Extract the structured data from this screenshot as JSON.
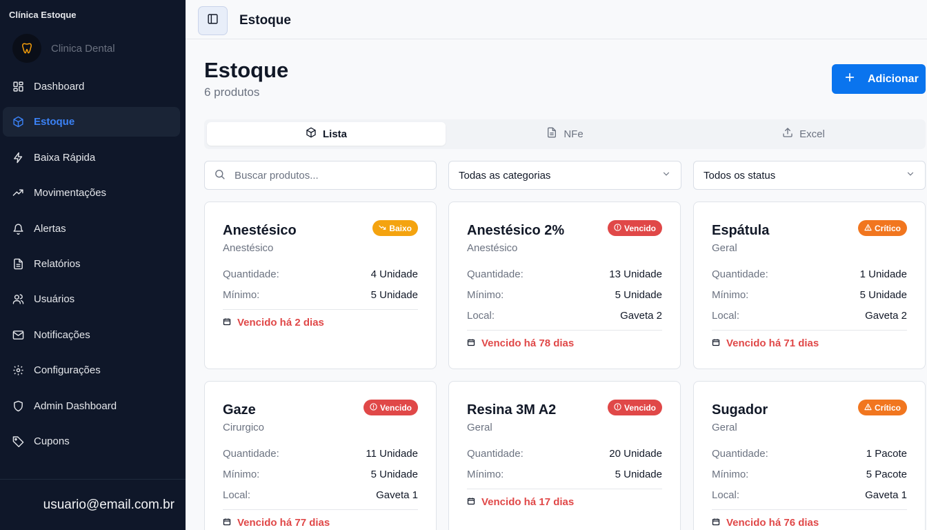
{
  "app": {
    "title": "Clínica Estoque",
    "clinic_name": "Clinica Dental"
  },
  "sidebar": {
    "items": [
      {
        "label": "Dashboard",
        "icon": "grid-icon"
      },
      {
        "label": "Estoque",
        "icon": "box-icon",
        "active": true
      },
      {
        "label": "Baixa Rápida",
        "icon": "zap-icon"
      },
      {
        "label": "Movimentações",
        "icon": "trending-icon"
      },
      {
        "label": "Alertas",
        "icon": "bell-icon"
      },
      {
        "label": "Relatórios",
        "icon": "file-icon"
      },
      {
        "label": "Usuários",
        "icon": "users-icon"
      },
      {
        "label": "Notificações",
        "icon": "mail-icon"
      },
      {
        "label": "Configurações",
        "icon": "gear-icon"
      },
      {
        "label": "Admin Dashboard",
        "icon": "shield-icon"
      },
      {
        "label": "Cupons",
        "icon": "tag-icon"
      }
    ],
    "user_email": "usuario@email.com.br"
  },
  "topbar": {
    "title": "Estoque"
  },
  "page": {
    "title": "Estoque",
    "subtitle": "6 produtos",
    "add_label": "Adicionar"
  },
  "tabs": [
    {
      "label": "Lista",
      "active": true
    },
    {
      "label": "NFe"
    },
    {
      "label": "Excel"
    }
  ],
  "filters": {
    "search_placeholder": "Buscar produtos...",
    "category": "Todas as categorias",
    "status": "Todos os status"
  },
  "labels": {
    "quantity": "Quantidade:",
    "minimum": "Mínimo:",
    "location": "Local:"
  },
  "products": [
    {
      "name": "Anestésico",
      "category": "Anestésico",
      "badge": "Baixo",
      "badge_color": "#f4a30f",
      "quantity": "4 Unidade",
      "minimum": "5 Unidade",
      "location": null,
      "expiry": "Vencido há 2 dias"
    },
    {
      "name": "Anestésico 2%",
      "category": "Anestésico",
      "badge": "Vencido",
      "badge_color": "#e04848",
      "quantity": "13 Unidade",
      "minimum": "5 Unidade",
      "location": "Gaveta 2",
      "expiry": "Vencido há 78 dias"
    },
    {
      "name": "Espátula",
      "category": "Geral",
      "badge": "Crítico",
      "badge_color": "#f1761f",
      "quantity": "1 Unidade",
      "minimum": "5 Unidade",
      "location": "Gaveta 2",
      "expiry": "Vencido há 71 dias"
    },
    {
      "name": "Gaze",
      "category": "Cirurgico",
      "badge": "Vencido",
      "badge_color": "#e04848",
      "quantity": "11 Unidade",
      "minimum": "5 Unidade",
      "location": "Gaveta 1",
      "expiry": "Vencido há 77 dias"
    },
    {
      "name": "Resina 3M A2",
      "category": "Geral",
      "badge": "Vencido",
      "badge_color": "#e04848",
      "quantity": "20 Unidade",
      "minimum": "5 Unidade",
      "location": null,
      "expiry": "Vencido há 17 dias"
    },
    {
      "name": "Sugador",
      "category": "Geral",
      "badge": "Crítico",
      "badge_color": "#f1761f",
      "quantity": "1 Pacote",
      "minimum": "5 Pacote",
      "location": "Gaveta 1",
      "expiry": "Vencido há 76 dias"
    }
  ],
  "colors": {
    "accent": "#0a74ee",
    "sidebar_bg": "#0f1729",
    "danger": "#e04848",
    "warning": "#f1761f",
    "low": "#f4a30f"
  }
}
